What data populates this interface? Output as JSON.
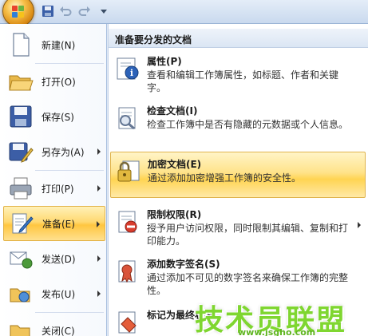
{
  "left_menu": {
    "items": [
      {
        "label": "新建(N)",
        "icon": "new-document-icon",
        "has_submenu": false
      },
      {
        "label": "打开(O)",
        "icon": "open-folder-icon",
        "has_submenu": false
      },
      {
        "label": "保存(S)",
        "icon": "save-disk-icon",
        "has_submenu": false
      },
      {
        "label": "另存为(A)",
        "icon": "save-as-icon",
        "has_submenu": true
      },
      {
        "label": "打印(P)",
        "icon": "printer-icon",
        "has_submenu": true
      },
      {
        "label": "准备(E)",
        "icon": "prepare-pen-icon",
        "has_submenu": true,
        "selected": true
      },
      {
        "label": "发送(D)",
        "icon": "send-icon",
        "has_submenu": true
      },
      {
        "label": "发布(U)",
        "icon": "publish-icon",
        "has_submenu": true
      },
      {
        "label": "关闭(C)",
        "icon": "close-folder-icon",
        "has_submenu": false
      }
    ]
  },
  "submenu": {
    "header": "准备要分发的文档",
    "items": [
      {
        "title": "属性(P)",
        "desc": "查看和编辑工作簿属性，如标题、作者和关键字。",
        "icon": "properties-icon"
      },
      {
        "title": "检查文档(I)",
        "desc": "检查工作簿中是否有隐藏的元数据或个人信息。",
        "icon": "inspect-document-icon"
      },
      {
        "title": "加密文档(E)",
        "desc": "通过添加加密增强工作簿的安全性。",
        "icon": "encrypt-lock-icon",
        "selected": true
      },
      {
        "title": "限制权限(R)",
        "desc": "授予用户访问权限，同时限制其编辑、复制和打印能力。",
        "icon": "restrict-permission-icon",
        "has_submenu": true
      },
      {
        "title": "添加数字签名(S)",
        "desc": "通过添加不可见的数字签名来确保工作簿的完整性。",
        "icon": "digital-signature-icon"
      },
      {
        "title": "标记为最终状态",
        "desc": "",
        "icon": "mark-final-icon"
      }
    ]
  },
  "watermark": {
    "text": "技术员联盟",
    "url": "www.jsgho.com"
  },
  "colors": {
    "selection": "#ffd971",
    "accent": "#15428b",
    "watermark": "#7fd630"
  }
}
